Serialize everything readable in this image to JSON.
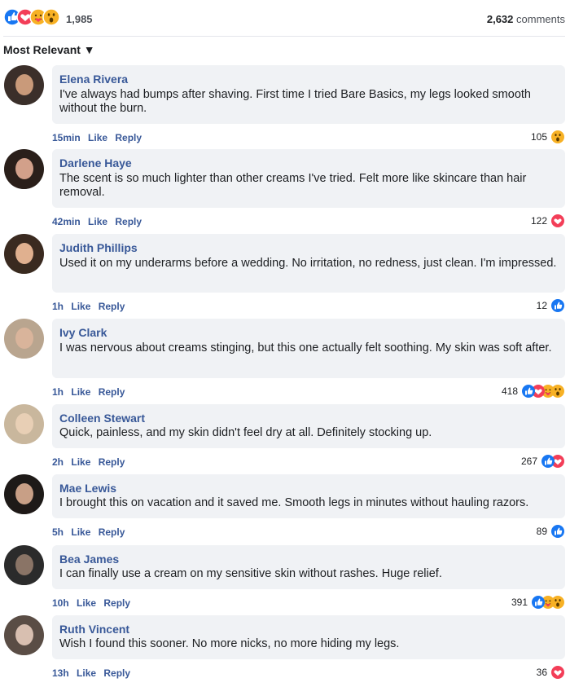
{
  "summary": {
    "total_reactions": "1,985",
    "comment_count": "2,632",
    "comments_label": "comments"
  },
  "sort": {
    "label": "Most Relevant ▼"
  },
  "colors": {
    "bubble": "#f0f2f5",
    "name": "#385898",
    "like": "#1877f2",
    "love": "#f33e58",
    "care": "#f7b125"
  },
  "comments": [
    {
      "name": "Elena Rivera",
      "text": "I've always had bumps after shaving. First time I tried Bare Basics, my legs looked smooth without the burn.",
      "time": "15min",
      "like": "Like",
      "reply": "Reply",
      "count": "105",
      "reactions": [
        "wow"
      ]
    },
    {
      "name": "Darlene Haye",
      "text": "The scent is so much lighter than other creams I've tried. Felt more like skincare than hair removal.",
      "time": "42min",
      "like": "Like",
      "reply": "Reply",
      "count": "122",
      "reactions": [
        "love"
      ]
    },
    {
      "name": "Judith Phillips",
      "text": "Used it on my underarms before a wedding. No irritation, no redness, just clean. I'm impressed.",
      "time": "1h",
      "like": "Like",
      "reply": "Reply",
      "count": "12",
      "reactions": [
        "like"
      ]
    },
    {
      "name": "Ivy Clark",
      "text": "I was nervous about creams stinging, but this one actually felt soothing. My skin was soft after.",
      "time": "1h",
      "like": "Like",
      "reply": "Reply",
      "count": "418",
      "reactions": [
        "like",
        "love",
        "care",
        "wow"
      ]
    },
    {
      "name": "Colleen Stewart",
      "text": "Quick, painless, and my skin didn't feel dry at all. Definitely stocking up.",
      "time": "2h",
      "like": "Like",
      "reply": "Reply",
      "count": "267",
      "reactions": [
        "like",
        "love"
      ]
    },
    {
      "name": "Mae Lewis",
      "text": "I brought this on vacation and it saved me. Smooth legs in minutes without hauling razors.",
      "time": "5h",
      "like": "Like",
      "reply": "Reply",
      "count": "89",
      "reactions": [
        "like"
      ]
    },
    {
      "name": "Bea James",
      "text": "I can finally use a cream on my sensitive skin without rashes. Huge relief.",
      "time": "10h",
      "like": "Like",
      "reply": "Reply",
      "count": "391",
      "reactions": [
        "like",
        "care",
        "wow"
      ]
    },
    {
      "name": "Ruth Vincent",
      "text": "Wish I found this sooner. No more nicks, no more hiding my legs.",
      "time": "13h",
      "like": "Like",
      "reply": "Reply",
      "count": "36",
      "reactions": [
        "love"
      ]
    }
  ]
}
